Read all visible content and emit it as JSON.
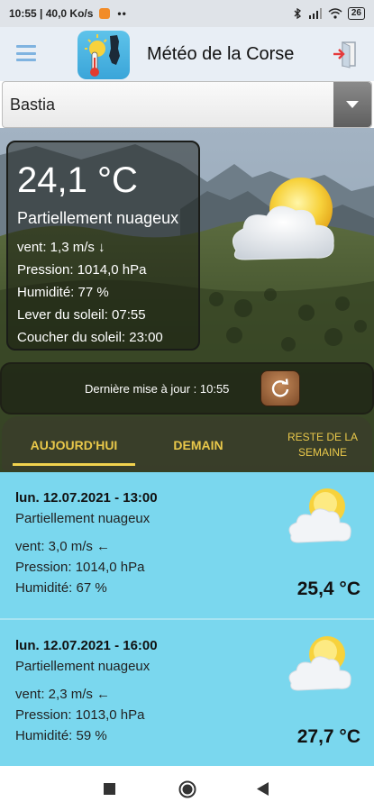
{
  "status_bar": {
    "time_speed": "10:55 | 40,0 Ko/s",
    "dots": "••",
    "battery": "26"
  },
  "app_bar": {
    "title": "Météo de la Corse",
    "menu_icon": "hamburger-menu-icon",
    "exit_icon": "exit-door-icon"
  },
  "city_select": {
    "value": "Bastia"
  },
  "current": {
    "temperature": "24,1 °C",
    "description": "Partiellement nuageux",
    "wind": "vent: 1,3 m/s ↓",
    "pressure": "Pression: 1014,0 hPa",
    "humidity": "Humidité: 77 %",
    "sunrise": "Lever du soleil: 07:55",
    "sunset": "Coucher du soleil: 23:00",
    "weather_icon": "partly-cloudy-icon"
  },
  "update": {
    "text": "Dernière mise à jour : 10:55",
    "refresh_icon": "refresh-icon"
  },
  "tabs": [
    {
      "label": "AUJOURD'HUI",
      "active": true
    },
    {
      "label": "DEMAIN",
      "active": false
    },
    {
      "label": "RESTE DE LA SEMAINE",
      "active": false
    }
  ],
  "forecast": [
    {
      "datetime": "lun. 12.07.2021 - 13:00",
      "description": "Partiellement nuageux",
      "wind": "vent: 3,0 m/s ←",
      "pressure": "Pression: 1014,0 hPa",
      "humidity": "Humidité: 67 %",
      "temperature": "25,4 °C"
    },
    {
      "datetime": "lun. 12.07.2021 - 16:00",
      "description": "Partiellement nuageux",
      "wind": "vent: 2,3 m/s ←",
      "pressure": "Pression: 1013,0 hPa",
      "humidity": "Humidité: 59 %",
      "temperature": "27,7 °C"
    }
  ],
  "colors": {
    "tab_active": "#f2d24e",
    "list_background": "#7ad7ee",
    "app_bar": "#e8eef5"
  }
}
